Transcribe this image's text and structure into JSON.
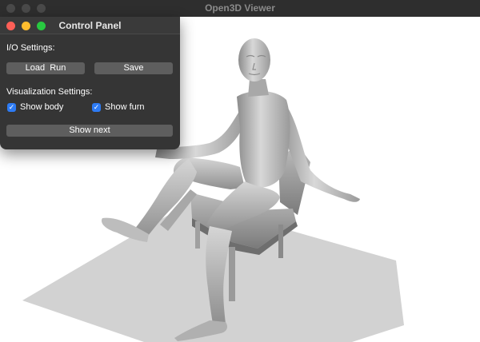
{
  "window": {
    "title": "Open3D Viewer"
  },
  "panel": {
    "title": "Control Panel",
    "io_label": "I/O Settings:",
    "load_run_label": "Load  Run",
    "save_label": "Save",
    "vis_label": "Visualization Settings:",
    "show_body_label": "Show body",
    "show_body_checked": true,
    "show_furn_label": "Show furn",
    "show_furn_checked": true,
    "show_next_label": "Show next"
  },
  "icons": {
    "check": "✓"
  },
  "colors": {
    "accent": "#2d7bf4",
    "close": "#fe5f57",
    "minimize": "#febc2e",
    "zoom": "#28c840",
    "floor": "#d2d2d2"
  }
}
